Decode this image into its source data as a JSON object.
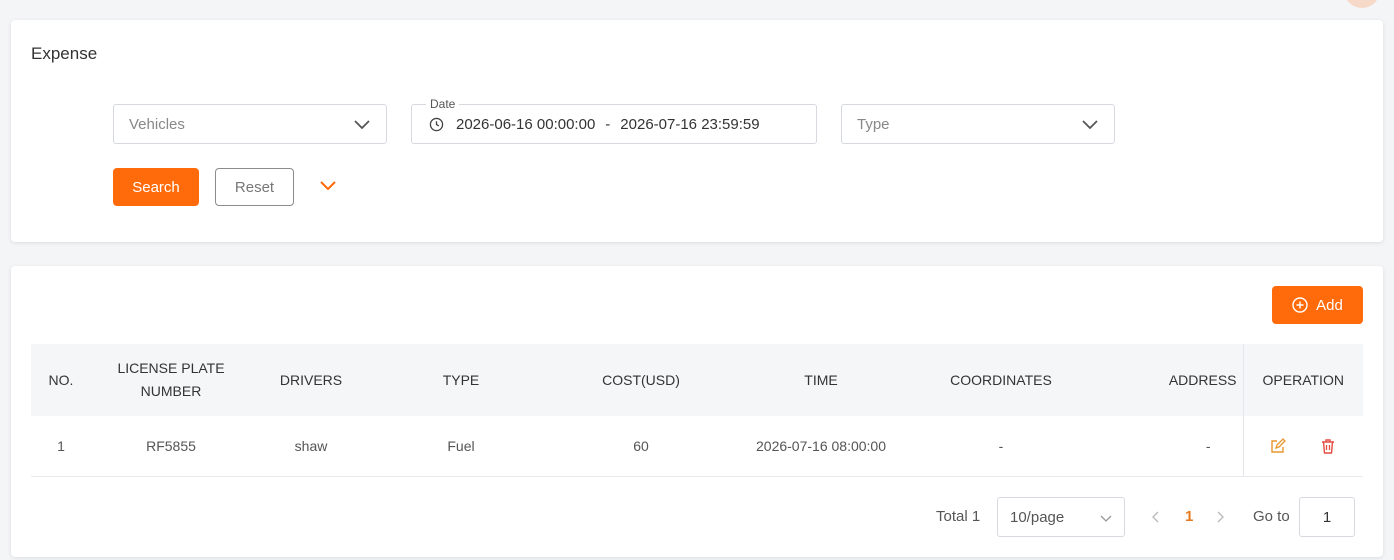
{
  "page": {
    "title": "Expense"
  },
  "filters": {
    "vehicles_placeholder": "Vehicles",
    "date_label": "Date",
    "date_start": "2026-06-16 00:00:00",
    "date_separator": "-",
    "date_end": "2026-07-16 23:59:59",
    "type_placeholder": "Type",
    "search_label": "Search",
    "reset_label": "Reset"
  },
  "table": {
    "add_label": "Add",
    "columns": [
      "NO.",
      "LICENSE PLATE NUMBER",
      "DRIVERS",
      "TYPE",
      "COST(USD)",
      "TIME",
      "COORDINATES",
      "ADDRESS",
      "OPERATION"
    ],
    "rows": [
      {
        "no": "1",
        "plate": "RF5855",
        "driver": "shaw",
        "type": "Fuel",
        "cost": "60",
        "time": "2026-07-16 08:00:00",
        "coordinates": "-",
        "address": "-"
      }
    ]
  },
  "pagination": {
    "total_label": "Total 1",
    "page_size": "10/page",
    "current_page": "1",
    "goto_label": "Go to",
    "goto_value": "1"
  },
  "colors": {
    "accent": "#ff6b0a",
    "danger": "#e54d42"
  },
  "icons": [
    "chevron-down-icon",
    "clock-icon",
    "plus-circle-icon",
    "edit-icon",
    "delete-icon",
    "chevron-left-icon",
    "chevron-right-icon"
  ]
}
